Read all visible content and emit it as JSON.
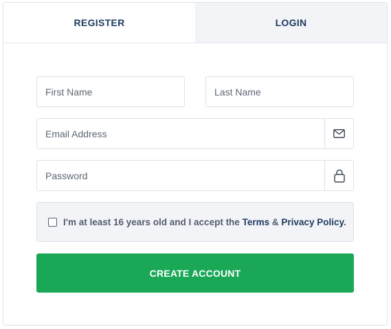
{
  "tabs": {
    "register_label": "REGISTER",
    "login_label": "LOGIN"
  },
  "fields": {
    "first_name_placeholder": "First Name",
    "last_name_placeholder": "Last Name",
    "email_placeholder": "Email Address",
    "password_placeholder": "Password",
    "email_icon": "envelope-icon",
    "password_icon": "lock-icon"
  },
  "consent": {
    "text_before": "I'm at least 16 years old and I accept the",
    "terms_link": "Terms",
    "ampersand": "&",
    "privacy_link": "Privacy Policy",
    "period": ".",
    "checked": false
  },
  "submit": {
    "label": "CREATE ACCOUNT"
  },
  "colors": {
    "accent_green": "#1aa857",
    "link_navy": "#1f3a5f",
    "inactive_tab_bg": "#f2f4f8"
  }
}
